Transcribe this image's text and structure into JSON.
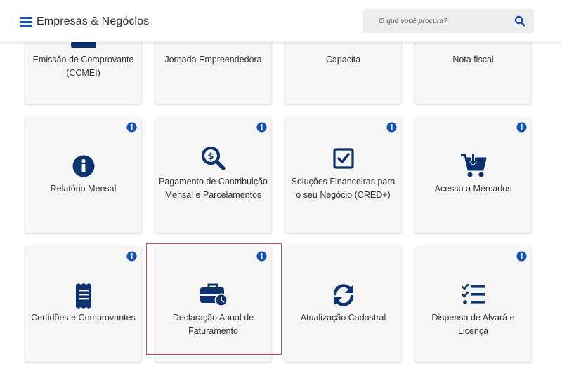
{
  "header": {
    "title": "Empresas & Negócios",
    "search_placeholder": "O que você procura?"
  },
  "colors": {
    "accent": "#1351b4",
    "icon_dark": "#0c326f",
    "highlight": "#e04646"
  },
  "cards": [
    {
      "label": "Emissão de Comprovante (CCMEI)",
      "icon": "user-icon"
    },
    {
      "label": "Jornada Empreendedora",
      "icon": "user-icon"
    },
    {
      "label": "Capacita",
      "icon": "user-icon"
    },
    {
      "label": "Nota fiscal",
      "icon": "user-icon"
    },
    {
      "label": "Relatório Mensal",
      "icon": "info-circle-icon"
    },
    {
      "label": "Pagamento de Contribuição Mensal e Parcelamentos",
      "icon": "search-dollar-icon"
    },
    {
      "label": "Soluções Financeiras para o seu Negócio (CRED+)",
      "icon": "check-square-icon"
    },
    {
      "label": "Acesso a Mercados",
      "icon": "cart-icon"
    },
    {
      "label": "Certidões e Comprovantes",
      "icon": "receipt-icon"
    },
    {
      "label": "Declaração Anual de Faturamento",
      "icon": "briefcase-clock-icon"
    },
    {
      "label": "Atualização Cadastral",
      "icon": "sync-icon"
    },
    {
      "label": "Dispensa de Alvará e Licença",
      "icon": "tasks-icon"
    }
  ]
}
